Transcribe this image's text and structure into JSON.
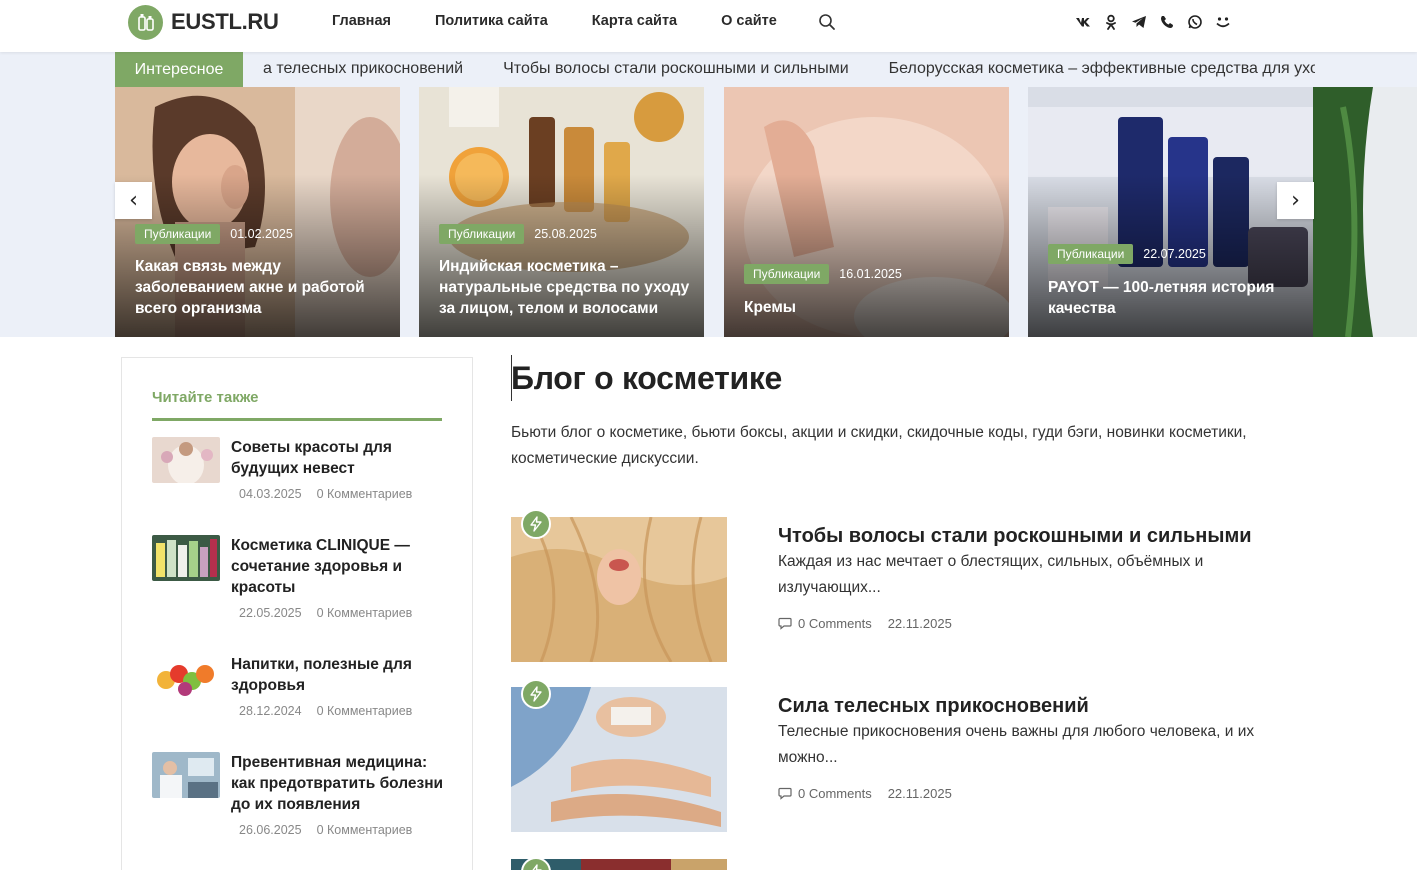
{
  "header": {
    "logo": "EUSTL.RU",
    "nav": [
      "Главная",
      "Политика сайта",
      "Карта сайта",
      "О сайте"
    ],
    "socials": [
      {
        "icon": "vk-icon",
        "glyph": "VK"
      },
      {
        "icon": "odnoklassniki-icon",
        "glyph": "OK"
      },
      {
        "icon": "telegram-icon",
        "glyph": "TG"
      },
      {
        "icon": "viber-icon",
        "glyph": "VB"
      },
      {
        "icon": "whatsapp-icon",
        "glyph": "WA"
      },
      {
        "icon": "moimir-icon",
        "glyph": "MM"
      }
    ]
  },
  "ticker": {
    "label": "Интересное",
    "items": [
      "а телесных прикосновений",
      "Чтобы волосы стали роскошными и сильными",
      "Белорусская косметика – эффективные средства для ухода"
    ]
  },
  "slider": {
    "prev": "‹",
    "next": "›",
    "slides": [
      {
        "tag": "Публикации",
        "date": "01.02.2025",
        "title": "Какая связь между заболеванием акне и работой всего организма"
      },
      {
        "tag": "Публикации",
        "date": "25.08.2025",
        "title": "Индийская косметика – натуральные средства по уходу за лицом, телом и волосами"
      },
      {
        "tag": "Публикации",
        "date": "16.01.2025",
        "title": "Кремы"
      },
      {
        "tag": "Публикации",
        "date": "22.07.2025",
        "title": "PAYOT — 100-летняя история качества"
      }
    ]
  },
  "sidebar": {
    "title": "Читайте также",
    "items": [
      {
        "title": "Советы красоты для будущих невест",
        "date": "04.03.2025",
        "comments": "0 Комментариев"
      },
      {
        "title": "Косметика CLINIQUE — сочетание здоровья и красоты",
        "date": "22.05.2025",
        "comments": "0 Комментариев"
      },
      {
        "title": "Напитки, полезные для здоровья",
        "date": "28.12.2024",
        "comments": "0 Комментариев"
      },
      {
        "title": "Превентивная медицина: как предотвратить болезни до их появления",
        "date": "26.06.2025",
        "comments": "0 Комментариев"
      }
    ]
  },
  "main": {
    "title": "Блог о косметике",
    "intro": "Бьюти блог о косметике, бьюти боксы, акции и скидки, скидочные коды, гуди бэги, новинки косметики, косметические дискуссии.",
    "posts": [
      {
        "title": "Чтобы волосы стали роскошными и сильными",
        "excerpt": "Каждая из нас мечтает о блестящих, сильных, объёмных и излучающих...",
        "comments": "0 Comments",
        "date": "22.11.2025"
      },
      {
        "title": "Сила телесных прикосновений",
        "excerpt": "Телесные прикосновения очень важны для любого человека, и их можно...",
        "comments": "0 Comments",
        "date": "22.11.2025"
      }
    ]
  },
  "colors": {
    "accent": "#7fa865",
    "ticker_bg": "#ecf0f8"
  }
}
